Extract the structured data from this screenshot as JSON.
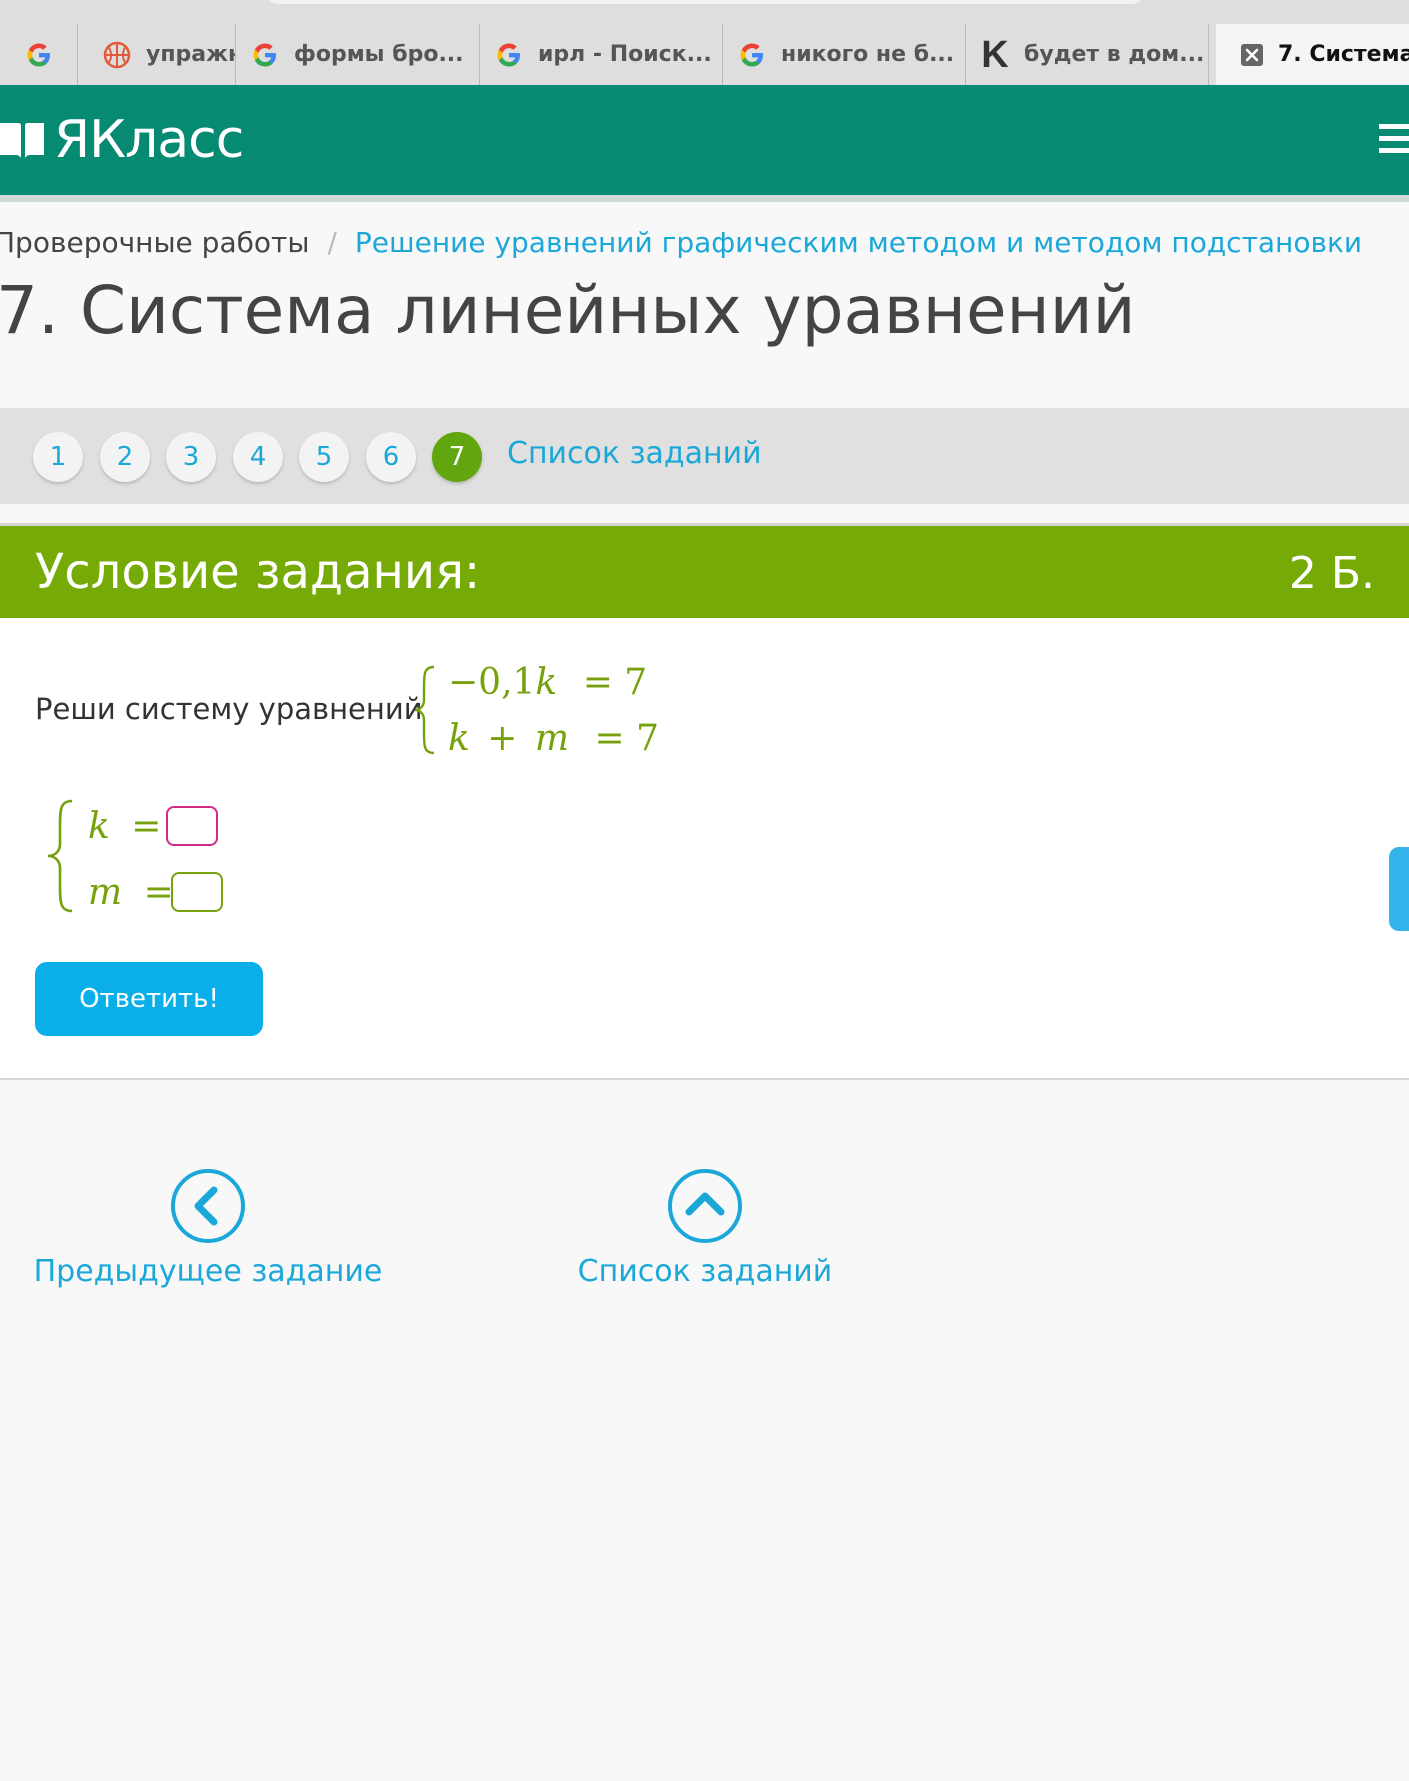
{
  "browser": {
    "tabs": [
      {
        "icon": "google-icon",
        "title": ""
      },
      {
        "icon": "ball-icon",
        "title": "упражн"
      },
      {
        "icon": "google-icon",
        "title": "формы бро..."
      },
      {
        "icon": "google-icon",
        "title": "ирл - Поиск..."
      },
      {
        "icon": "google-icon",
        "title": "никого не б..."
      },
      {
        "icon": "k-icon",
        "title": "будет в дом..."
      },
      {
        "icon": "close-icon",
        "title": "7. Система..."
      }
    ]
  },
  "header": {
    "logo_text": "ЯКласс",
    "brand_color": "#068a72"
  },
  "breadcrumb": {
    "first": "Проверочные работы",
    "separator": "/",
    "link": "Решение уравнений графическим методом и методом подстановки"
  },
  "page_title": "7. Система линейных уравнений",
  "task_nav": {
    "items": [
      "1",
      "2",
      "3",
      "4",
      "5",
      "6",
      "7"
    ],
    "current": "7",
    "list_link": "Список заданий"
  },
  "condition": {
    "title": "Условие задания:",
    "points": "2 Б.",
    "prompt": "Реши систему уравнений",
    "equations": {
      "eq1_left": "−0,1",
      "eq1_var": "k",
      "eq1_right": "= 7",
      "eq2_var1": "k",
      "eq2_op": "+",
      "eq2_var2": "m",
      "eq2_right": "= 7"
    },
    "answers": {
      "k_label": "k",
      "m_label": "m",
      "equals": "=",
      "k_value": "",
      "m_value": ""
    },
    "submit_label": "Ответить!"
  },
  "bottom_nav": {
    "prev_label": "Предыдущее задание",
    "list_label": "Список заданий"
  }
}
